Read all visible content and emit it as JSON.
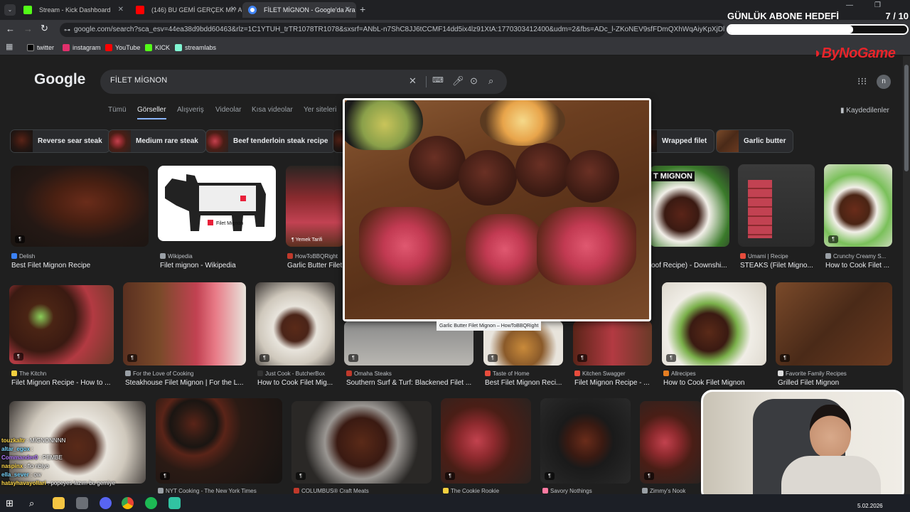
{
  "browser": {
    "tabs": [
      {
        "label": "Stream - Kick Dashboard",
        "color": "#53fc18"
      },
      {
        "label": "(146) BU GEMİ GERÇEK Mİ? Am",
        "color": "#ff0000"
      },
      {
        "label": "FİLET MİGNON - Google'da Ara",
        "color": "#8ab4f8"
      }
    ],
    "url": "google.com/search?sca_esv=44ea38d9bdd60463&rlz=1C1YTUH_trTR1078TR1078&sxsrf=ANbL-n7ShC8JJ6tCCMF14dd5ix4lz91XtA:1770303412400&udm=2&fbs=ADc_l-ZKoNEV9sfFDmQXhWqAiyKpXjDltWOsMiVMWcA_Atd",
    "bookmarks": [
      {
        "label": "twitter",
        "color": "#000000"
      },
      {
        "label": "instagram",
        "color": "#e1306c"
      },
      {
        "label": "YouTube",
        "color": "#ff0000"
      },
      {
        "label": "KICK",
        "color": "#53fc18"
      },
      {
        "label": "streamlabs",
        "color": "#80f5d2"
      }
    ]
  },
  "google": {
    "logo": "Google",
    "query": "FİLET MİGNON",
    "avatar": "n",
    "nav": [
      "Tümü",
      "Görseller",
      "Alışveriş",
      "Videolar",
      "Kısa videolar",
      "Yer siteleri"
    ],
    "saved": "Kaydedilenler",
    "chips": [
      "Reverse sear steak",
      "Medium rare steak",
      "Beef tenderloin steak recipe",
      "Wrapped filet",
      "Garlic butter"
    ],
    "row1": [
      {
        "source": "Delish",
        "title": "Best Filet Mignon Recipe",
        "color": "#3b82f6"
      },
      {
        "source": "Wikipedia",
        "title": "Filet mignon - Wikipedia",
        "color": "#9aa0a6"
      },
      {
        "source": "HowToBBQRight",
        "title": "Garlic Butter Filet",
        "color": "#c0392b"
      },
      {
        "source": "",
        "title": "oof Recipe) - Downshi...",
        "color": "#555555"
      },
      {
        "source": "Umami | Recipe",
        "title": "STEAKS (Filet Migno...",
        "color": "#e74c3c"
      },
      {
        "source": "Crunchy Creamy S...",
        "title": "How to Cook Filet ...",
        "color": "#9aa0a6"
      }
    ],
    "row1_overlays": {
      "cut_label": "Filet Mignon",
      "source_tag": "Yemek Tarifi",
      "banner": "T MIGNON"
    },
    "row2": [
      {
        "source": "The Kitchn",
        "title": "Filet Mignon Recipe - How to ...",
        "color": "#f4d03f"
      },
      {
        "source": "For the Love of Cooking",
        "title": "Steakhouse Filet Mignon | For the L...",
        "color": "#9aa0a6"
      },
      {
        "source": "Just Cook - ButcherBox",
        "title": "How to Cook Filet Mig...",
        "color": "#333333"
      },
      {
        "source": "Omaha Steaks",
        "title": "Southern Surf & Turf: Blackened Filet ...",
        "color": "#c0392b"
      },
      {
        "source": "Taste of Home",
        "title": "Best Filet Mignon Reci...",
        "color": "#e74c3c"
      },
      {
        "source": "Kitchen Swagger",
        "title": "Filet Mignon Recipe - ...",
        "color": "#e74c3c"
      },
      {
        "source": "Allrecipes",
        "title": "How to Cook Filet Mignon",
        "color": "#e67e22"
      },
      {
        "source": "Favorite Family Recipes",
        "title": "Grilled Filet Mignon",
        "color": "#dddddd"
      }
    ],
    "row3": [
      {
        "source": "NYT Cooking - The New York Times",
        "color": "#9aa0a6"
      },
      {
        "source": "COLUMBUS® Craft Meats",
        "color": "#c0392b"
      },
      {
        "source": "The Cookie Rookie",
        "color": "#f4d03f"
      },
      {
        "source": "Savory Nothings",
        "color": "#ff7aa2"
      },
      {
        "source": "Zimmy's Nook",
        "color": "#9aa0a6"
      }
    ],
    "preview_caption": "Garlic Butter Filet Mignon – HowToBBQRight"
  },
  "stream_overlay": {
    "goal_title": "GÜNLÜK ABONE HEDEFİ",
    "goal_count": "7 / 10",
    "goal_progress": 0.7,
    "brand": "ByNoGame",
    "chat": [
      {
        "user": "touzkaltr",
        "msg": ": MİGNONNNN",
        "color": "#ffd84a"
      },
      {
        "user": "altar_egox",
        "msg": ":",
        "color": "#7ad7ff"
      },
      {
        "user": "Commander0",
        "msg": ": PEMBE",
        "color": "#b57aff"
      },
      {
        "user": "naspinx",
        "msg": ": flo nbiyo",
        "color": "#ffd84a"
      },
      {
        "user": "ella_sever",
        "msg": ": ow",
        "color": "#7ad7ff"
      },
      {
        "user": "hatayhavayollari",
        "msg": ": popeyes lazım bu gemiye",
        "color": "#ffd84a"
      }
    ],
    "date": "5.02.2026"
  }
}
